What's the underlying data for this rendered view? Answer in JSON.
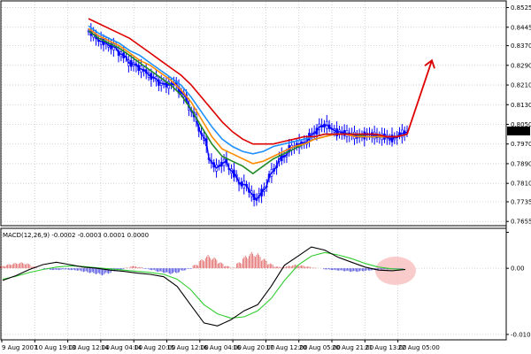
{
  "chart_data": [
    {
      "type": "candlestick",
      "panel": "price",
      "y_ticks": [
        "0.8525",
        "0.8445",
        "0.8370",
        "0.8290",
        "0.8210",
        "0.8130",
        "0.8050",
        "0.7970",
        "0.7890",
        "0.7810",
        "0.7735",
        "0.7655"
      ],
      "ylim": [
        0.7645,
        0.8545
      ],
      "current_price_label": "0.8026",
      "grid": true,
      "close_path": [
        [
          0.843,
          0.84
        ],
        [
          0.839,
          0.838
        ],
        [
          0.837,
          0.836
        ],
        [
          0.834,
          0.832
        ],
        [
          0.83,
          0.829
        ],
        [
          0.828,
          0.826
        ],
        [
          0.825,
          0.823
        ],
        [
          0.822,
          0.821
        ],
        [
          0.821,
          0.822
        ],
        [
          0.819,
          0.815
        ],
        [
          0.812,
          0.806
        ],
        [
          0.803,
          0.796
        ],
        [
          0.791,
          0.786
        ],
        [
          0.788,
          0.791
        ],
        [
          0.787,
          0.783
        ],
        [
          0.781,
          0.78
        ],
        [
          0.778,
          0.773
        ],
        [
          0.776,
          0.781
        ],
        [
          0.784,
          0.789
        ],
        [
          0.791,
          0.793
        ],
        [
          0.795,
          0.797
        ],
        [
          0.797,
          0.798
        ],
        [
          0.8,
          0.803
        ],
        [
          0.804,
          0.805
        ],
        [
          0.804,
          0.801
        ],
        [
          0.802,
          0.801
        ],
        [
          0.801,
          0.8
        ],
        [
          0.8,
          0.801
        ],
        [
          0.801,
          0.8
        ],
        [
          0.8,
          0.8
        ],
        [
          0.799,
          0.8
        ],
        [
          0.801,
          0.802
        ]
      ],
      "series": [
        {
          "color": "#1e90ff",
          "values": [
            0.845,
            0.842,
            0.84,
            0.838,
            0.835,
            0.833,
            0.83,
            0.827,
            0.824,
            0.821,
            0.816,
            0.81,
            0.804,
            0.799,
            0.796,
            0.794,
            0.793,
            0.794,
            0.796,
            0.797,
            0.798,
            0.799,
            0.8,
            0.801,
            0.801,
            0.801,
            0.801,
            0.8,
            0.8,
            0.8,
            0.8,
            0.801
          ]
        },
        {
          "color": "#228b22",
          "values": [
            0.843,
            0.84,
            0.838,
            0.836,
            0.833,
            0.83,
            0.827,
            0.824,
            0.821,
            0.817,
            0.811,
            0.804,
            0.797,
            0.792,
            0.79,
            0.788,
            0.785,
            0.788,
            0.791,
            0.793,
            0.795,
            0.797,
            0.799,
            0.8,
            0.801,
            0.801,
            0.801,
            0.8,
            0.8,
            0.8,
            0.8,
            0.801
          ]
        },
        {
          "color": "#ff8c00",
          "values": [
            0.844,
            0.841,
            0.839,
            0.837,
            0.834,
            0.831,
            0.829,
            0.826,
            0.823,
            0.819,
            0.814,
            0.807,
            0.8,
            0.795,
            0.793,
            0.791,
            0.789,
            0.79,
            0.792,
            0.794,
            0.796,
            0.797,
            0.799,
            0.8,
            0.801,
            0.801,
            0.8,
            0.8,
            0.8,
            0.8,
            0.8,
            0.801
          ]
        },
        {
          "color": "#dd0000",
          "values": [
            0.848,
            0.846,
            0.844,
            0.842,
            0.84,
            0.837,
            0.834,
            0.831,
            0.828,
            0.825,
            0.821,
            0.816,
            0.811,
            0.806,
            0.802,
            0.799,
            0.797,
            0.797,
            0.797,
            0.798,
            0.799,
            0.8,
            0.8,
            0.801,
            0.801,
            0.801,
            0.801,
            0.801,
            0.801,
            0.8,
            0.8,
            0.801
          ]
        }
      ],
      "forecast_arrow": {
        "color": "#dd0000",
        "from": [
          0.801
        ],
        "to": [
          0.831
        ]
      }
    },
    {
      "type": "macd",
      "panel": "indicator",
      "title": "MACD(12,26,9) -0.0002 -0.0003 0.0001 0.0000",
      "y_ticks": [
        "0.00",
        "-0.0109"
      ],
      "ylim": [
        -0.0115,
        0.006
      ],
      "histogram": [
        0.0004,
        0.0007,
        0.0009,
        0.001,
        0.0008,
        0.0003,
        0.0,
        -0.0002,
        -0.0003,
        -0.0003,
        -0.0002,
        -0.0003,
        -0.0004,
        -0.0006,
        -0.0008,
        -0.001,
        -0.0012,
        -0.0009,
        -0.0005,
        -0.0002,
        0.0001,
        0.0004,
        0.0002,
        -0.0001,
        -0.0003,
        -0.0006,
        -0.0008,
        -0.001,
        -0.0008,
        -0.0004,
        -0.0001,
        0.0006,
        0.0015,
        0.0022,
        0.0018,
        0.001,
        0.0004,
        0.0001,
        0.001,
        0.0021,
        0.0027,
        0.0025,
        0.0016,
        0.0008,
        0.0003,
        0.0002,
        0.0004,
        0.0006,
        0.0005,
        0.0003,
        0.0001,
        0.0,
        -0.0002,
        -0.0003,
        -0.0004,
        -0.0005,
        -0.0006,
        -0.0006,
        -0.0005,
        -0.0004,
        -0.0003,
        -0.0002,
        -0.0002,
        -0.0001,
        -0.0001,
        0.0
      ],
      "macd_line": [
        -0.002,
        -0.0012,
        -0.0002,
        0.0006,
        0.001,
        0.0006,
        0.0002,
        0.0,
        -0.0003,
        -0.0005,
        -0.0008,
        -0.001,
        -0.0014,
        -0.003,
        -0.006,
        -0.009,
        -0.0095,
        -0.0085,
        -0.007,
        -0.006,
        -0.003,
        0.0005,
        0.002,
        0.0035,
        0.003,
        0.0018,
        0.001,
        0.0002,
        -0.0003,
        -0.0004,
        -0.0002
      ],
      "signal_line": [
        -0.0018,
        -0.0013,
        -0.0007,
        -0.0002,
        0.0002,
        0.0004,
        0.0003,
        0.0001,
        -0.0001,
        -0.0003,
        -0.0005,
        -0.0007,
        -0.001,
        -0.0018,
        -0.0035,
        -0.006,
        -0.0075,
        -0.0082,
        -0.008,
        -0.007,
        -0.005,
        -0.002,
        0.0005,
        0.002,
        0.0026,
        0.0022,
        0.0016,
        0.0008,
        0.0002,
        -0.0001,
        -0.0002
      ],
      "highlight": {
        "color": "#f7b9b9"
      }
    }
  ],
  "x_ticks": [
    "9 Aug 2007",
    "10 Aug 19:00",
    "13 Aug 12:00",
    "14 Aug 04:00",
    "14 Aug 20:00",
    "15 Aug 12:00",
    "16 Aug 04:00",
    "16 Aug 20:00",
    "17 Aug 12:00",
    "20 Aug 05:00",
    "20 Aug 21:00",
    "21 Aug 13:00",
    "22 Aug 05:00"
  ],
  "colors": {
    "candle": "#0000ff",
    "macd_hist_pos": "#e06060",
    "macd_hist_neg": "#4040e0",
    "macd": "#000000",
    "signal": "#32cd32",
    "grid": "#c8c8c8"
  }
}
